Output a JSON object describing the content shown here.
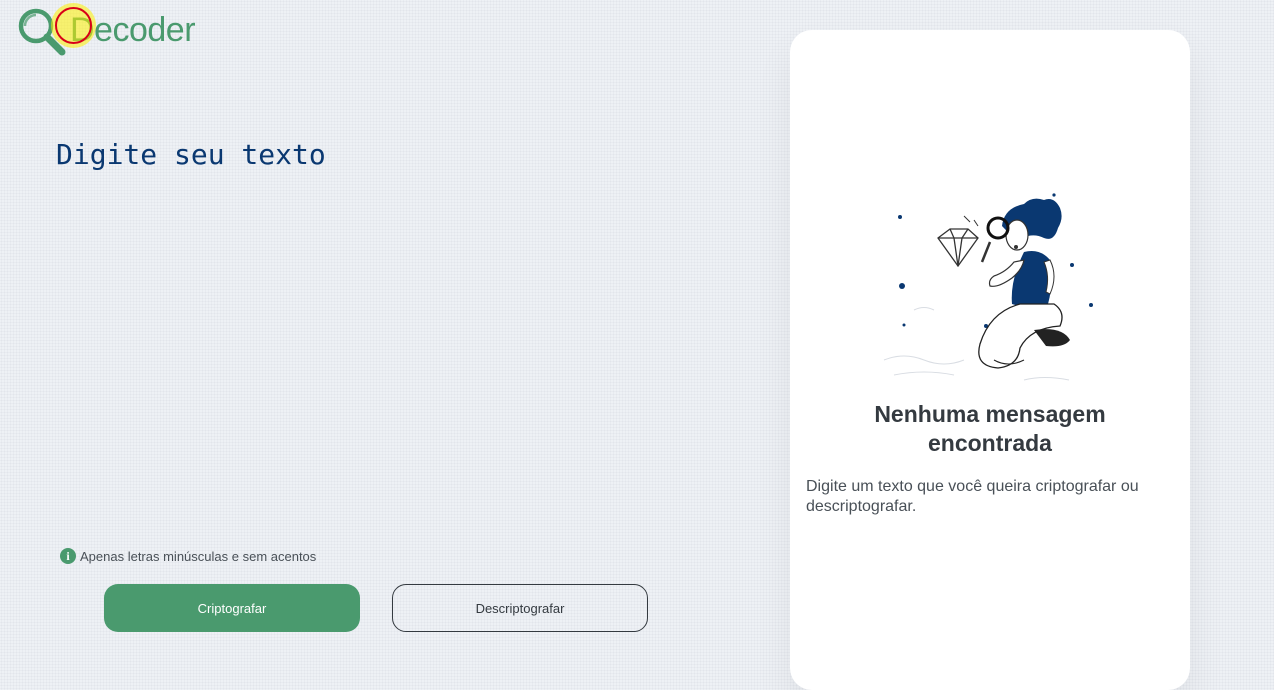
{
  "logo": {
    "text": "Decoder",
    "icon": "magnifier-icon",
    "color": "#4a9a6e"
  },
  "input": {
    "placeholder": "Digite seu texto",
    "value": "",
    "text_color": "#0a3871"
  },
  "hint": {
    "icon": "info-icon",
    "text": "Apenas letras minúsculas e sem acentos"
  },
  "buttons": {
    "encrypt_label": "Criptografar",
    "decrypt_label": "Descriptografar",
    "accent": "#4a9a6e"
  },
  "output": {
    "illustration": "person-with-magnifier-illustration",
    "title": "Nenhuma mensagem encontrada",
    "description": "Digite um texto que você queira criptografar ou descriptografar."
  }
}
